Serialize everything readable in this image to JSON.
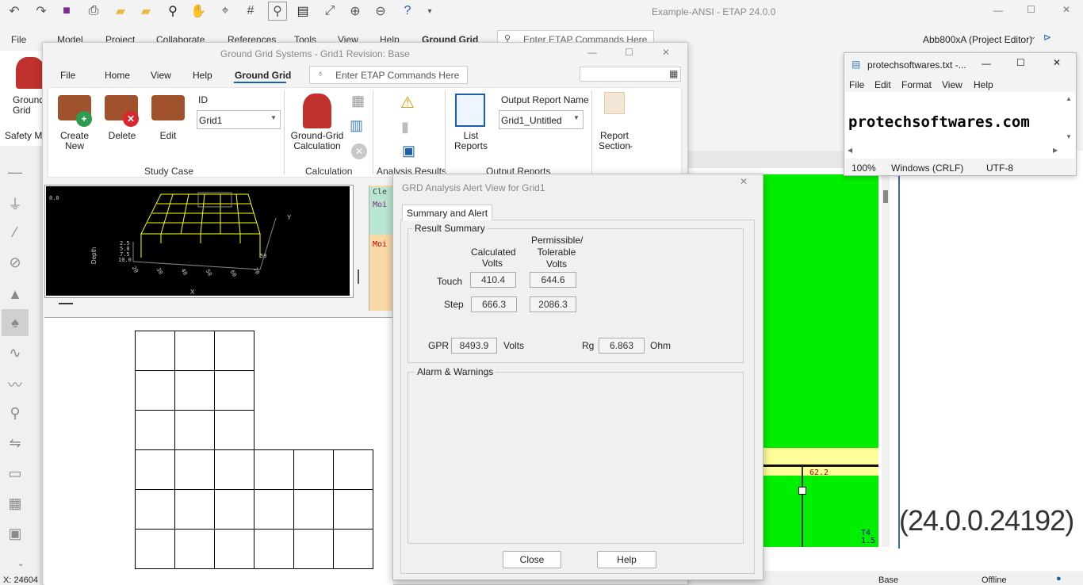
{
  "app": {
    "title": "Example-ANSI - ETAP 24.0.0",
    "menu": [
      "File",
      "Model",
      "Project",
      "Collaborate",
      "References",
      "Tools",
      "View",
      "Help",
      "Ground Grid"
    ],
    "command_placeholder": "Enter ETAP Commands Here",
    "user_mode": "Abb800xA (Project Editor)",
    "left_ribbon_label": "Ground Grid",
    "safety_label": "Safety Mo",
    "status_coord": "X: 24604",
    "status_base": "Base",
    "status_offline": "Offline",
    "version": "(24.0.0.24192)",
    "colors": {
      "accent": "#1a5fa8",
      "green_canvas": "#00ee00",
      "yellow_bus": "#ffff99"
    }
  },
  "ground_grid_window": {
    "title": "Ground Grid Systems - Grid1   Revision: Base",
    "tabs": [
      "File",
      "Home",
      "View",
      "Help",
      "Ground Grid"
    ],
    "active_tab": "Ground Grid",
    "command_placeholder": "Enter ETAP Commands Here",
    "study_case": {
      "create_new": "Create New",
      "delete": "Delete",
      "edit": "Edit",
      "id_label": "ID",
      "id_value": "Grid1",
      "group": "Study Case"
    },
    "calculation": {
      "button": "Ground-Grid Calculation",
      "group": "Calculation"
    },
    "analysis_results": {
      "group": "Analysis Results"
    },
    "output_reports": {
      "list_reports": "List Reports",
      "output_report_name_label": "Output Report Name",
      "output_report_name_value": "Grid1_Untitled",
      "group": "Output Reports"
    },
    "report_section": "Report Section",
    "plot3d": {
      "depth_label": "Depth",
      "x_label": "X",
      "y_label": "Y",
      "zero": "0.0",
      "depth_ticks": [
        "2.5",
        "5.0",
        "7.5",
        "10.0"
      ],
      "x_ticks": [
        "20",
        "30",
        "40",
        "50",
        "60",
        "70"
      ],
      "y_tick": "50"
    }
  },
  "notepad": {
    "title": "protechsoftwares.txt -...",
    "menu": [
      "File",
      "Edit",
      "Format",
      "View",
      "Help"
    ],
    "content": "protechsoftwares.com",
    "status_zoom": "100%",
    "status_eol": "Windows (CRLF)",
    "status_encoding": "UTF-8"
  },
  "alert_dialog": {
    "title": "GRD Analysis Alert View for Grid1",
    "tab": "Summary and Alert",
    "result_summary_label": "Result Summary",
    "col_calculated": "Calculated Volts",
    "col_permissible": "Permissible/ Tolerable Volts",
    "touch_label": "Touch",
    "touch_calculated": "410.4",
    "touch_permissible": "644.6",
    "step_label": "Step",
    "step_calculated": "666.3",
    "step_permissible": "2086.3",
    "gpr_label": "GPR",
    "gpr_value": "8493.9",
    "gpr_unit": "Volts",
    "rg_label": "Rg",
    "rg_value": "6.863",
    "rg_unit": "Ohm",
    "alarm_label": "Alarm & Warnings",
    "close_button": "Close",
    "help_button": "Help"
  },
  "oneline": {
    "bus_value": "62.2",
    "transformer_label": "T4",
    "transformer_rating": "1.5",
    "side_labels": [
      "Cle",
      "Moi",
      "Moi"
    ]
  }
}
